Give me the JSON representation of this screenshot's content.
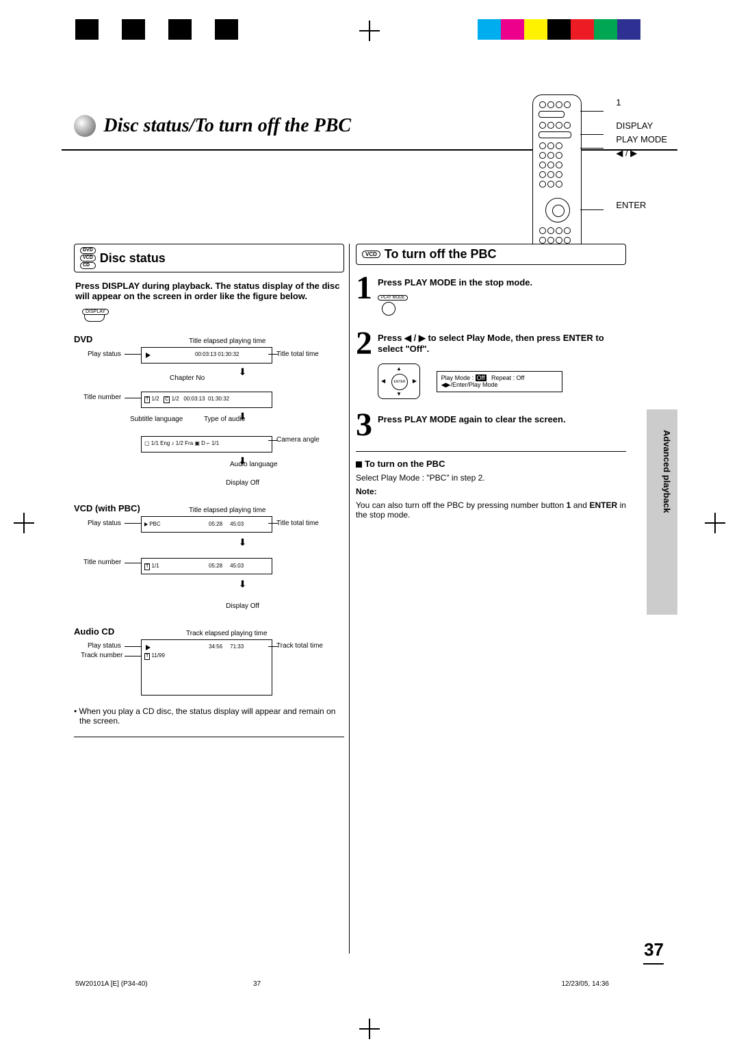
{
  "page_title": "Disc status/To turn off the PBC",
  "remote": {
    "callouts": [
      "1",
      "DISPLAY",
      "PLAY MODE",
      "◀ / ▶",
      "ENTER"
    ]
  },
  "left": {
    "heading_ovals": [
      "DVD",
      "VCD",
      "CD"
    ],
    "heading": "Disc status",
    "intro": "Press DISPLAY during playback. The status display of the disc will appear on the screen in order like the figure below.",
    "display_btn": "DISPLAY",
    "dvd": {
      "label": "DVD",
      "top_note": "Title elapsed playing time",
      "play_status": "Play status",
      "title_total": "Title total time",
      "osd1_times": "00:03:13  01:30:32",
      "chapter_no": "Chapter No",
      "title_number": "Title number",
      "osd2_labels": "T 1/2     C 1/2    00:03:13  01:30:32",
      "subtitle_lang": "Subtitle language",
      "type_audio": "Type of audio",
      "osd3_labels": "▢ 1/1 Eng  ♪ 1/2 Fra ▣ D  ⌐ 1/1",
      "camera": "Camera angle",
      "audio_lang": "Audio language",
      "display_off": "Display Off"
    },
    "vcd": {
      "label": "VCD (with PBC)",
      "top_note": "Title elapsed playing time",
      "play_status": "Play status",
      "title_total": "Title total time",
      "osd1": "▶ PBC            05:28      45:03",
      "title_number": "Title number",
      "osd2": "T 1/1               05:28      45:03",
      "display_off": "Display Off"
    },
    "cd": {
      "label": "Audio CD",
      "top_note": "Track elapsed playing time",
      "play_status": "Play status",
      "track_total": "Track total time",
      "track_number": "Track number",
      "osd": "▶                    34:56      71:33",
      "osd2": "T 11/99"
    },
    "cd_note": "When you play a CD disc, the status display will appear and remain on the screen."
  },
  "right": {
    "heading_oval": "VCD",
    "heading": "To turn off the PBC",
    "step1": "Press PLAY MODE in the stop mode.",
    "step1_btn": "PLAY MODE",
    "step2": "Press ◀ / ▶ to select Play Mode, then press ENTER to select \"Off\".",
    "osd_line1_a": "Play Mode  :",
    "osd_line1_b": "Off",
    "osd_line1_c": "Repeat   :   Off",
    "osd_line2": "◀▶/Enter/Play Mode",
    "enter_label": "ENTER",
    "step3": "Press PLAY MODE again to clear the screen.",
    "turn_on_head": "To turn on the PBC",
    "turn_on_body": "Select Play Mode : \"PBC\" in step 2.",
    "note_label": "Note:",
    "note_body_a": "You can also turn off the PBC by pressing number button ",
    "note_body_b": "1",
    "note_body_c": " and ",
    "note_body_d": "ENTER",
    "note_body_e": " in the stop mode."
  },
  "side_tab": "Advanced playback",
  "page_number": "37",
  "footer": {
    "left": "5W20101A [E] (P34-40)",
    "mid": "37",
    "right": "12/23/05, 14:36"
  }
}
